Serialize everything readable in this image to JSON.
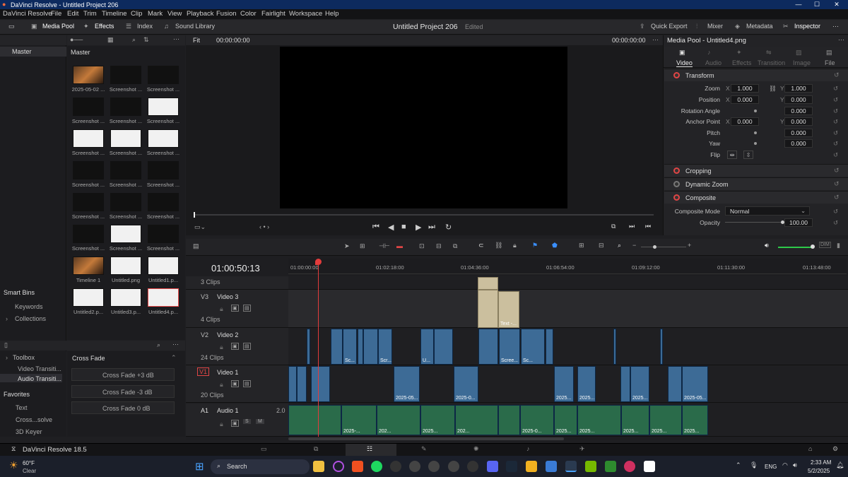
{
  "titlebar": {
    "title": "DaVinci Resolve - Untitled Project 206",
    "min": "—",
    "max": "☐",
    "close": "✕"
  },
  "menu": [
    "DaVinci Resolve",
    "File",
    "Edit",
    "Trim",
    "Timeline",
    "Clip",
    "Mark",
    "View",
    "Playback",
    "Fusion",
    "Color",
    "Fairlight",
    "Workspace",
    "Help"
  ],
  "toolbar": {
    "media_pool": "Media Pool",
    "effects": "Effects",
    "index": "Index",
    "sound_library": "Sound Library",
    "project": "Untitled Project 206",
    "edited": "Edited",
    "quick_export": "Quick Export",
    "mixer": "Mixer",
    "metadata": "Metadata",
    "inspector": "Inspector"
  },
  "leftpanel": {
    "master": "Master",
    "smart_bins": "Smart Bins",
    "keywords": "Keywords",
    "collections": "Collections"
  },
  "mediapool": {
    "header": "Master",
    "items": [
      "2025-05-02 ...",
      "Screenshot ...",
      "Screenshot ...",
      "Screenshot ...",
      "Screenshot ...",
      "Screenshot ...",
      "Screenshot ...",
      "Screenshot ...",
      "Screenshot ...",
      "Screenshot ...",
      "Screenshot ...",
      "Screenshot ...",
      "Screenshot ...",
      "Screenshot ...",
      "Screenshot ...",
      "Screenshot ...",
      "Screenshot ...",
      "Screenshot ...",
      "Timeline 1",
      "Untitled.png",
      "Untitled1.p...",
      "Untitled2.p...",
      "Untitled3.p...",
      "Untitled4.p..."
    ]
  },
  "viewer": {
    "fit": "Fit",
    "tc_left": "00:00:00:00",
    "tc_right": "00:00:00:00"
  },
  "inspector": {
    "title": "Media Pool - Untitled4.png",
    "tabs": [
      "Video",
      "Audio",
      "Effects",
      "Transition",
      "Image",
      "File"
    ],
    "transform": "Transform",
    "zoom_label": "Zoom",
    "zoom_x": "1.000",
    "zoom_y": "1.000",
    "position_label": "Position",
    "pos_x": "0.000",
    "pos_y": "0.000",
    "rotation_label": "Rotation Angle",
    "rotation": "0.000",
    "anchor_label": "Anchor Point",
    "anchor_x": "0.000",
    "anchor_y": "0.000",
    "pitch_label": "Pitch",
    "pitch": "0.000",
    "yaw_label": "Yaw",
    "yaw": "0.000",
    "flip_label": "Flip",
    "x": "X",
    "y": "Y",
    "cropping": "Cropping",
    "dynamic_zoom": "Dynamic Zoom",
    "composite": "Composite",
    "composite_mode_label": "Composite Mode",
    "composite_mode": "Normal",
    "opacity_label": "Opacity",
    "opacity": "100.00"
  },
  "effects": {
    "toolbox": "Toolbox",
    "video_transitions": "Video Transiti...",
    "audio_transitions": "Audio Transiti...",
    "favorites": "Favorites",
    "fav_items": [
      "Text",
      "Cross...solve",
      "3D Keyer"
    ],
    "list_title": "Cross Fade",
    "list": [
      "Cross Fade +3 dB",
      "Cross Fade -3 dB",
      "Cross Fade 0 dB"
    ]
  },
  "timeline": {
    "timecode": "01:00:50:13",
    "ruler": [
      "01:00:00:00",
      "01:02:18:00",
      "01:04:36:00",
      "01:06:54:00",
      "01:09:12:00",
      "01:11:30:00",
      "01:13:48:00"
    ],
    "above_v3": "3 Clips",
    "v3": {
      "id": "V3",
      "name": "Video 3",
      "clips": "4 Clips"
    },
    "v2": {
      "id": "V2",
      "name": "Video 2",
      "clips": "24 Clips"
    },
    "v1": {
      "id": "V1",
      "name": "Video 1",
      "clips": "20 Clips"
    },
    "a1": {
      "id": "A1",
      "name": "Audio 1",
      "ch": "2.0",
      "s": "S",
      "m": "M"
    },
    "v3_clip_label": "Text -...",
    "v2_labels": [
      "Sc...",
      "Scr...",
      "U...",
      "Scree...",
      "Sc..."
    ],
    "v1_labels": [
      "2025-05...",
      "2025-0...",
      "2025...",
      "2025...",
      "2025...",
      "2025-05..."
    ],
    "a1_labels": [
      "2025-...",
      "202...",
      "2025...",
      "202...",
      "2025-0...",
      "2025...",
      "2025...",
      "2025...",
      "2025...",
      "2025..."
    ]
  },
  "footer": {
    "app": "DaVinci Resolve 18.5"
  },
  "taskbar": {
    "temp": "60°F",
    "weather": "Clear",
    "search": "Search",
    "lang": "ENG",
    "time": "2:33 AM",
    "date": "5/2/2025"
  }
}
